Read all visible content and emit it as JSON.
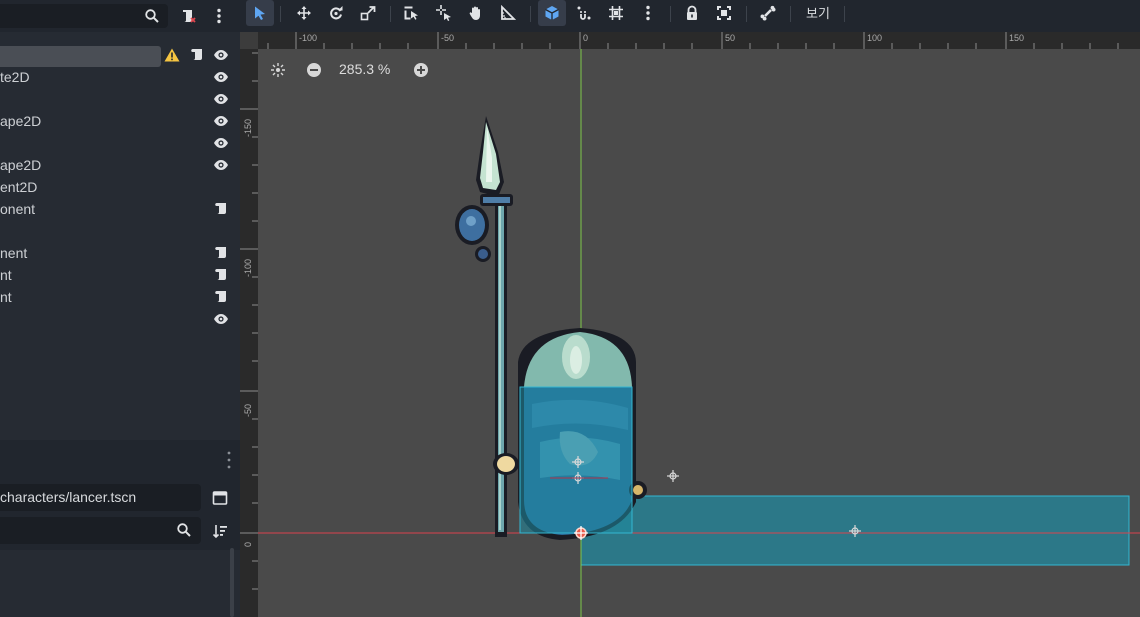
{
  "scene_dock": {
    "filter_placeholder": "",
    "rows": [
      {
        "label": "",
        "selected": true,
        "warning": true,
        "script": true,
        "visible_icon": true
      },
      {
        "label": "te2D",
        "visible_icon": true
      },
      {
        "label": "",
        "visible_icon": true
      },
      {
        "label": "ape2D",
        "visible_icon": true
      },
      {
        "label": "",
        "visible_icon": true
      },
      {
        "label": "ape2D",
        "visible_icon": true
      },
      {
        "label": "ent2D"
      },
      {
        "label": "onent",
        "script": true
      },
      {
        "label": ""
      },
      {
        "label": "nent",
        "script": true
      },
      {
        "label": "nt",
        "script": true
      },
      {
        "label": "nt",
        "script": true
      },
      {
        "label": "",
        "visible_icon": true
      }
    ]
  },
  "filesystem": {
    "path": "characters/lancer.tscn",
    "search_placeholder": ""
  },
  "toolbar": {
    "tools": [
      "select-icon",
      "move-icon",
      "rotate-icon",
      "scale-icon",
      "list-select-icon",
      "pivot-icon",
      "pan-icon",
      "ruler-icon",
      "smart-snap-icon",
      "snap-options-icon",
      "grid-icon",
      "more-icon",
      "lock-icon",
      "group-icon",
      "bone-icon"
    ],
    "view_menu": "보기"
  },
  "viewport": {
    "zoom": "285.3 %",
    "ruler_top": [
      "-100",
      "-50",
      "0",
      "50",
      "100",
      "150"
    ],
    "ruler_left": [
      "-150",
      "-100",
      "-50",
      "0"
    ],
    "colors": {
      "x_axis": "#d9434e",
      "y_axis": "#7fc84a",
      "collision": "#1f8ca3"
    }
  }
}
